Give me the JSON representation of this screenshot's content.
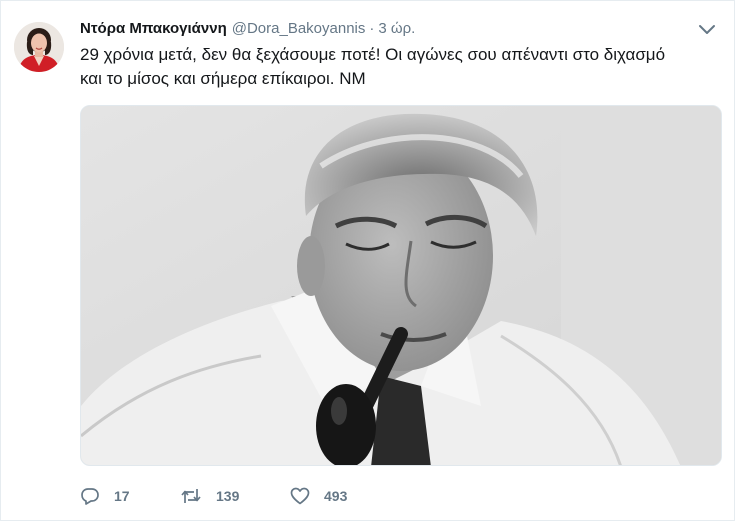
{
  "author": {
    "name": "Ντόρα Μπακογιάννη",
    "handle": "@Dora_Bakoyannis",
    "separator": "·",
    "time": "3 ώρ."
  },
  "tweet": {
    "text": "29 χρόνια μετά, δεν θα ξεχάσουμε ποτέ! Οι αγώνες σου απέναντι στο διχασμό\nκαι το μίσος και σήμερα επίκαιροι. ΝΜ"
  },
  "actions": {
    "reply": {
      "icon": "reply-icon",
      "count": "17"
    },
    "retweet": {
      "icon": "retweet-icon",
      "count": "139"
    },
    "like": {
      "icon": "heart-icon",
      "count": "493"
    }
  },
  "menu": {
    "icon": "chevron-down-icon"
  },
  "colors": {
    "text": "#14171a",
    "secondary": "#657786",
    "border": "#e6ecf0",
    "avatar_jacket": "#d01f26"
  }
}
